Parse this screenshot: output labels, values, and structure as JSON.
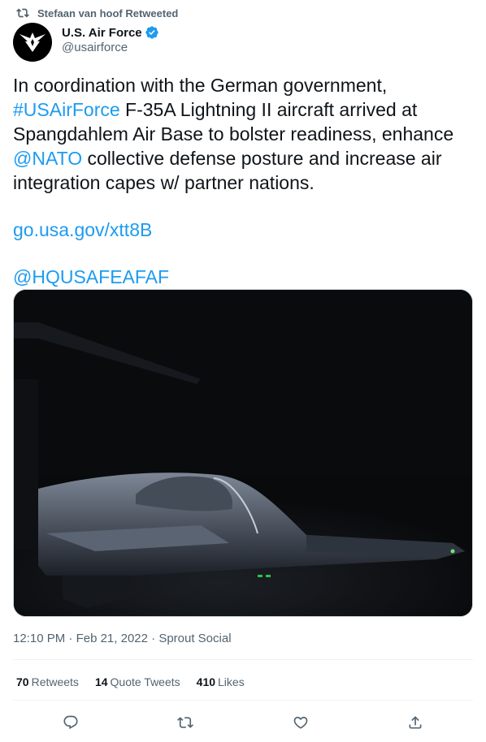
{
  "retweet_context": {
    "text": "Stefaan van hoof Retweeted",
    "icon": "retweet-icon"
  },
  "author": {
    "display_name": "U.S. Air Force",
    "handle": "@usairforce",
    "verified": true,
    "avatar_icon": "air-force-logo",
    "verified_color": "#1d9bf0"
  },
  "tweet": {
    "line1": "In coordination with the German government,",
    "hashtag": "#USAirForce",
    "after_hashtag": " F-35A Lightning II aircraft arrived at Spangdahlem Air Base to bolster readiness, enhance ",
    "mention_nato": "@NATO",
    "after_mention": " collective defense posture and increase air integration capes w/ partner nations.",
    "link": "go.usa.gov/xtt8B",
    "mention_hq": "@HQUSAFEAFAF"
  },
  "media": {
    "kind": "photo",
    "description_icon": "f35-aircraft-photo"
  },
  "meta": {
    "time": "12:10 PM",
    "date": "Feb 21, 2022",
    "source": "Sprout Social",
    "sep": " · "
  },
  "stats": {
    "retweets_count": "70",
    "retweets_label": "Retweets",
    "quotes_count": "14",
    "quotes_label": "Quote Tweets",
    "likes_count": "410",
    "likes_label": "Likes"
  },
  "colors": {
    "link": "#1d9bf0",
    "secondary_text": "#536471",
    "primary_text": "#0f1419"
  }
}
